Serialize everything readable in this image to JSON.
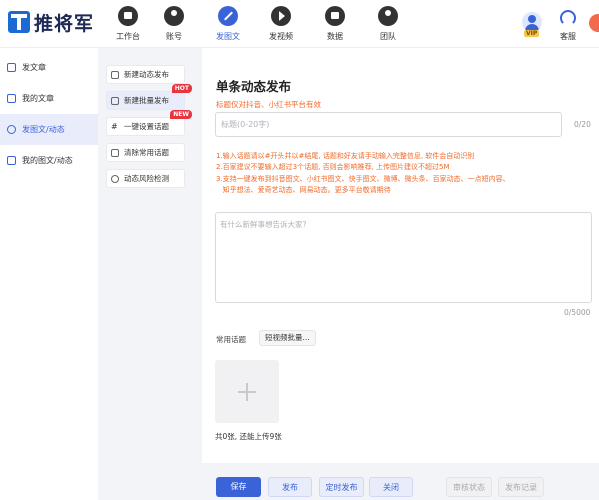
{
  "app": {
    "logo_text": "推将军"
  },
  "nav": [
    {
      "label": "工作台",
      "icon": "monitor-icon"
    },
    {
      "label": "账号",
      "icon": "user-icon"
    },
    {
      "label": "发图文",
      "icon": "pen-icon",
      "active": true
    },
    {
      "label": "发视频",
      "icon": "play-icon"
    },
    {
      "label": "数据",
      "icon": "chart-icon"
    },
    {
      "label": "团队",
      "icon": "team-icon"
    }
  ],
  "header_right": {
    "vip_badge": "VIP",
    "service_label": "客服"
  },
  "sidebar": [
    {
      "label": "发文章"
    },
    {
      "label": "我的文章"
    },
    {
      "label": "发图文/动态",
      "active": true
    },
    {
      "label": "我的图文/动态"
    }
  ],
  "submenu": [
    {
      "label": "新建动态发布"
    },
    {
      "label": "新建批量发布",
      "badge": "HOT",
      "active": true
    },
    {
      "label": "一键设置话题",
      "badge": "NEW"
    },
    {
      "label": "清除常用话题"
    },
    {
      "label": "动态风险检测"
    }
  ],
  "main": {
    "title": "单条动态发布",
    "title_note": "标题仅对抖音、小红书平台有效",
    "title_placeholder": "标题(0-20字)",
    "title_counter": "0/20",
    "tips": [
      "1.输入话题请以#开头并以#结尾, 话题和好友请手动输入完整信息, 软件会自动识别",
      "2.百家建议不要输入超过3个话题, 否则会影响推荐, 上传图片建议不超过5M",
      "3.支持一键发布到抖音图文、小红书图文、快手图文、微博、微头条、百家动态、一点短内容、",
      "   知乎想法、爱奇艺动态、网易动态。更多平台敬请期待"
    ],
    "content_placeholder": "有什么新鲜事想告诉大家?",
    "content_counter": "0/5000",
    "topics_label": "常用话题",
    "topics_button": "短视频批量...",
    "upload_count": "共0张, 还能上传9张"
  },
  "footer": {
    "save": "保存",
    "publish": "发布",
    "schedule": "定时发布",
    "close": "关闭",
    "audit": "审核状态",
    "records": "发布记录"
  },
  "colors": {
    "accent": "#3b63d8",
    "warning": "#f06a2a",
    "hot": "#e8353f"
  }
}
